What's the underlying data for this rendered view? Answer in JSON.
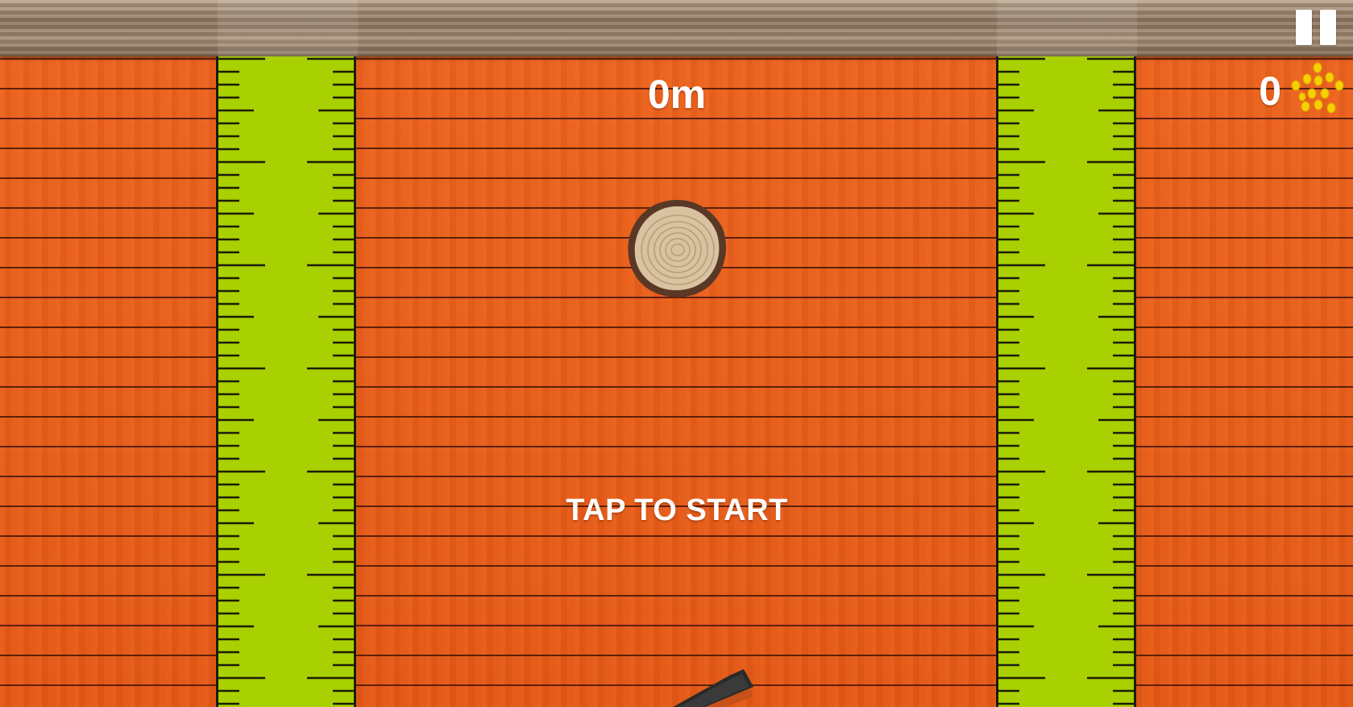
{
  "hud": {
    "distance": "0m",
    "coins": "0",
    "prompt": "TAP TO START"
  },
  "icons": {
    "pause": "pause-icon",
    "coin": "coin-cluster-icon",
    "log": "log-slice",
    "cutter": "saw-blade"
  },
  "colors": {
    "wood": "#e85f1c",
    "ruler": "#a9d000",
    "text": "#ffffff",
    "coin": "#f5d000"
  }
}
